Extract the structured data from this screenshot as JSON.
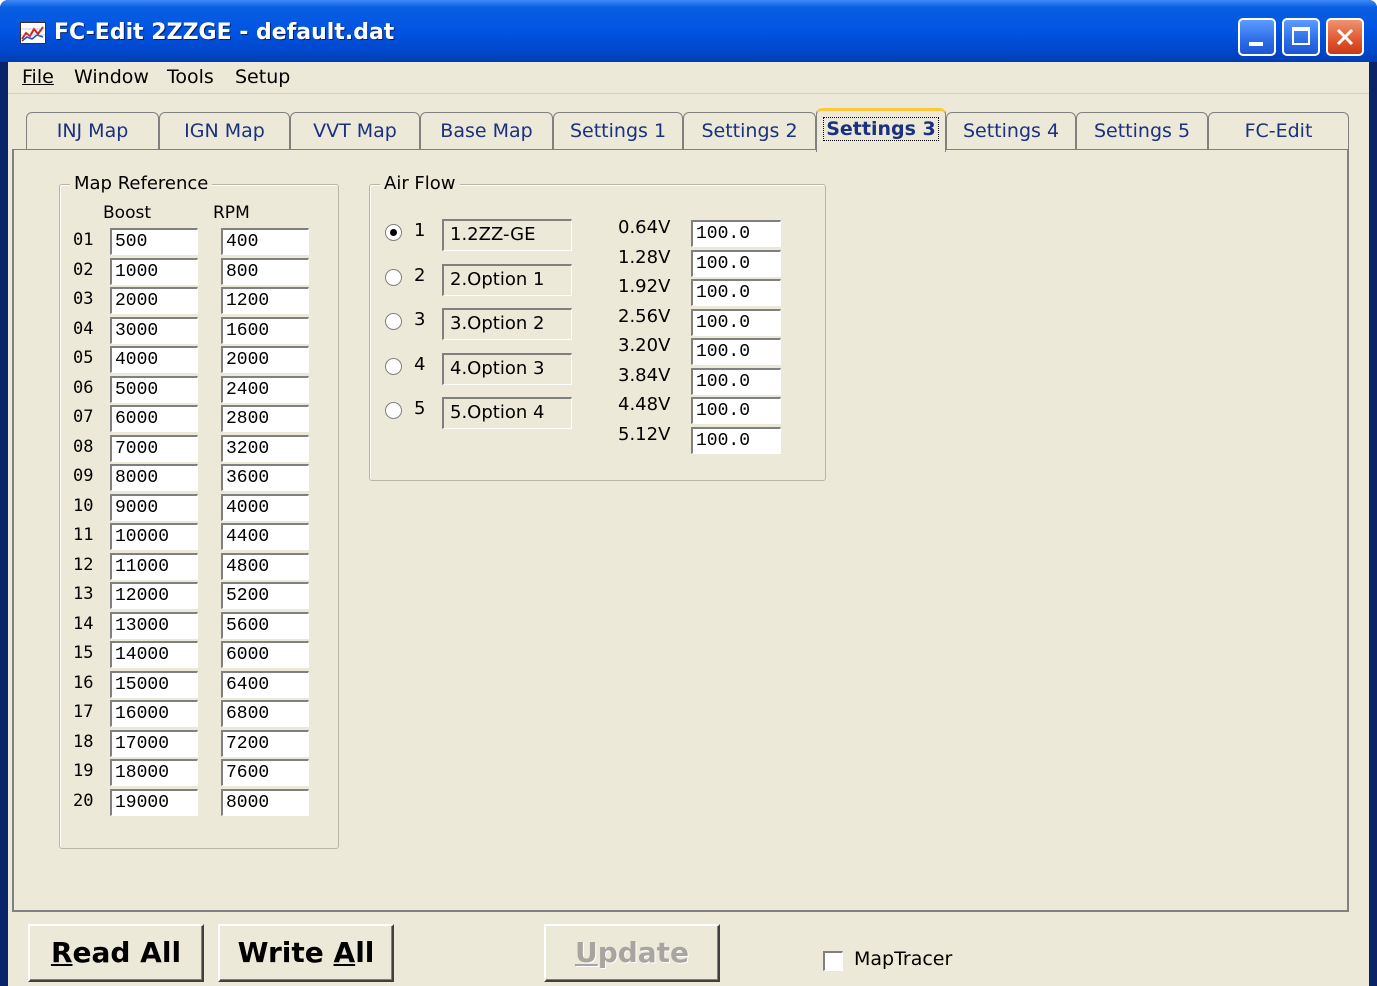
{
  "window": {
    "title": "FC-Edit 2ZZGE - default.dat"
  },
  "menu": [
    "File",
    "Window",
    "Tools",
    "Setup"
  ],
  "tabs": [
    {
      "label": "INJ Map",
      "active": false
    },
    {
      "label": "IGN Map",
      "active": false
    },
    {
      "label": "VVT Map",
      "active": false
    },
    {
      "label": "Base Map",
      "active": false
    },
    {
      "label": "Settings 1",
      "active": false
    },
    {
      "label": "Settings 2",
      "active": false
    },
    {
      "label": "Settings 3",
      "active": true
    },
    {
      "label": "Settings 4",
      "active": false
    },
    {
      "label": "Settings 5",
      "active": false
    },
    {
      "label": "FC-Edit",
      "active": false
    }
  ],
  "map_reference": {
    "title": "Map Reference",
    "boost_header": "Boost",
    "rpm_header": "RPM",
    "rows": [
      {
        "n": "01",
        "boost": "500",
        "rpm": "400"
      },
      {
        "n": "02",
        "boost": "1000",
        "rpm": "800"
      },
      {
        "n": "03",
        "boost": "2000",
        "rpm": "1200"
      },
      {
        "n": "04",
        "boost": "3000",
        "rpm": "1600"
      },
      {
        "n": "05",
        "boost": "4000",
        "rpm": "2000"
      },
      {
        "n": "06",
        "boost": "5000",
        "rpm": "2400"
      },
      {
        "n": "07",
        "boost": "6000",
        "rpm": "2800"
      },
      {
        "n": "08",
        "boost": "7000",
        "rpm": "3200"
      },
      {
        "n": "09",
        "boost": "8000",
        "rpm": "3600"
      },
      {
        "n": "10",
        "boost": "9000",
        "rpm": "4000"
      },
      {
        "n": "11",
        "boost": "10000",
        "rpm": "4400"
      },
      {
        "n": "12",
        "boost": "11000",
        "rpm": "4800"
      },
      {
        "n": "13",
        "boost": "12000",
        "rpm": "5200"
      },
      {
        "n": "14",
        "boost": "13000",
        "rpm": "5600"
      },
      {
        "n": "15",
        "boost": "14000",
        "rpm": "6000"
      },
      {
        "n": "16",
        "boost": "15000",
        "rpm": "6400"
      },
      {
        "n": "17",
        "boost": "16000",
        "rpm": "6800"
      },
      {
        "n": "18",
        "boost": "17000",
        "rpm": "7200"
      },
      {
        "n": "19",
        "boost": "18000",
        "rpm": "7600"
      },
      {
        "n": "20",
        "boost": "19000",
        "rpm": "8000"
      }
    ]
  },
  "air_flow": {
    "title": "Air Flow",
    "options": [
      {
        "num": "1",
        "label": "1.2ZZ-GE",
        "selected": true
      },
      {
        "num": "2",
        "label": "2.Option 1",
        "selected": false
      },
      {
        "num": "3",
        "label": "3.Option 2",
        "selected": false
      },
      {
        "num": "4",
        "label": "4.Option 3",
        "selected": false
      },
      {
        "num": "5",
        "label": "5.Option 4",
        "selected": false
      }
    ],
    "voltages": [
      {
        "v": "0.64V",
        "value": "100.0"
      },
      {
        "v": "1.28V",
        "value": "100.0"
      },
      {
        "v": "1.92V",
        "value": "100.0"
      },
      {
        "v": "2.56V",
        "value": "100.0"
      },
      {
        "v": "3.20V",
        "value": "100.0"
      },
      {
        "v": "3.84V",
        "value": "100.0"
      },
      {
        "v": "4.48V",
        "value": "100.0"
      },
      {
        "v": "5.12V",
        "value": "100.0"
      }
    ]
  },
  "buttons": {
    "read_all": {
      "accel": "R",
      "rest": "ead All"
    },
    "write_all": {
      "pre": "Write ",
      "accel": "A",
      "rest": "ll"
    },
    "update": {
      "accel": "U",
      "rest": "pdate",
      "disabled": true
    }
  },
  "maptracer": {
    "label": "MapTracer",
    "checked": false
  }
}
